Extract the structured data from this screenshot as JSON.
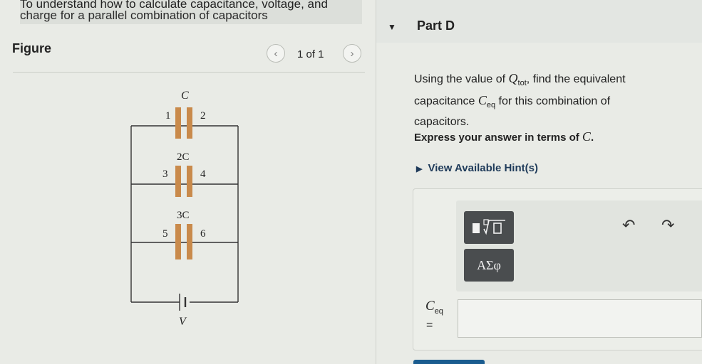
{
  "intro": {
    "line1": "To understand how to calculate capacitance, voltage, and",
    "line2": "charge for a parallel combination of capacitors"
  },
  "figure_panel": {
    "title": "Figure",
    "pager": {
      "prev_icon": "chevron-left-icon",
      "text": "1 of 1",
      "next_icon": "chevron-right-icon"
    },
    "circuit": {
      "capacitors": [
        {
          "label": "C",
          "left_node": "1",
          "right_node": "2"
        },
        {
          "label": "2C",
          "left_node": "3",
          "right_node": "4"
        },
        {
          "label": "3C",
          "left_node": "5",
          "right_node": "6"
        }
      ],
      "source_label": "V",
      "plate_color": "#c98a4b"
    }
  },
  "part": {
    "title": "Part D",
    "question_pre": "Using the value of ",
    "q_symbol": "Q",
    "q_sub": "tot",
    "question_mid": ", find the equivalent capacitance ",
    "c_symbol": "C",
    "c_sub": "eq",
    "question_post": " for this combination of capacitors.",
    "express_pre": "Express your answer in terms of ",
    "express_var": "C",
    "express_post": ".",
    "hint_label": "View Available Hint(s)"
  },
  "answer": {
    "toolbar": {
      "math_button_icon": "templates-radical-icon",
      "greek_button_label": "ΑΣφ",
      "undo_icon": "undo-icon",
      "redo_icon": "redo-icon"
    },
    "variable": "C",
    "variable_sub": "eq",
    "equals": "=",
    "input_value": ""
  },
  "colors": {
    "toolbar_button": "#4a4d4f",
    "hint_text": "#1f3b5a",
    "accent": "#1a5c8f"
  }
}
